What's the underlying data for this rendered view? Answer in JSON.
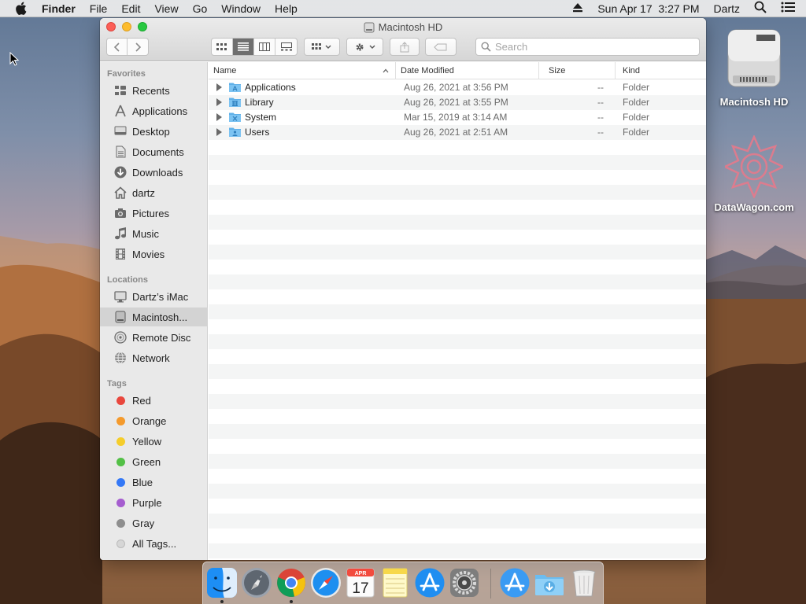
{
  "menubar": {
    "app_name": "Finder",
    "menus": [
      "File",
      "Edit",
      "View",
      "Go",
      "Window",
      "Help"
    ],
    "clock": "Sun Apr 17  3:27 PM",
    "user": "Dartz"
  },
  "window": {
    "title": "Macintosh HD",
    "search_placeholder": "Search"
  },
  "sidebar": {
    "favorites_header": "Favorites",
    "favorites": [
      {
        "label": "Recents",
        "icon": "recents-icon"
      },
      {
        "label": "Applications",
        "icon": "applications-icon"
      },
      {
        "label": "Desktop",
        "icon": "desktop-icon"
      },
      {
        "label": "Documents",
        "icon": "documents-icon"
      },
      {
        "label": "Downloads",
        "icon": "downloads-icon"
      },
      {
        "label": "dartz",
        "icon": "home-icon"
      },
      {
        "label": "Pictures",
        "icon": "pictures-icon"
      },
      {
        "label": "Music",
        "icon": "music-icon"
      },
      {
        "label": "Movies",
        "icon": "movies-icon"
      }
    ],
    "locations_header": "Locations",
    "locations": [
      {
        "label": "Dartz’s iMac",
        "icon": "imac-icon"
      },
      {
        "label": "Macintosh...",
        "icon": "hard-drive-icon",
        "selected": true
      },
      {
        "label": "Remote Disc",
        "icon": "remote-disc-icon"
      },
      {
        "label": "Network",
        "icon": "network-icon"
      }
    ],
    "tags_header": "Tags",
    "tags": [
      {
        "label": "Red",
        "color": "#e9473d"
      },
      {
        "label": "Orange",
        "color": "#f49a2c"
      },
      {
        "label": "Yellow",
        "color": "#f5cd2b"
      },
      {
        "label": "Green",
        "color": "#53c046"
      },
      {
        "label": "Blue",
        "color": "#3478f6"
      },
      {
        "label": "Purple",
        "color": "#a55dcf"
      },
      {
        "label": "Gray",
        "color": "#8e8e8e"
      },
      {
        "label": "All Tags...",
        "color": "#d6d6d6"
      }
    ]
  },
  "list": {
    "columns": {
      "name": "Name",
      "date": "Date Modified",
      "size": "Size",
      "kind": "Kind"
    },
    "rows": [
      {
        "name": "Applications",
        "date": "Aug 26, 2021 at 3:56 PM",
        "size": "--",
        "kind": "Folder"
      },
      {
        "name": "Library",
        "date": "Aug 26, 2021 at 3:55 PM",
        "size": "--",
        "kind": "Folder"
      },
      {
        "name": "System",
        "date": "Mar 15, 2019 at 3:14 AM",
        "size": "--",
        "kind": "Folder"
      },
      {
        "name": "Users",
        "date": "Aug 26, 2021 at 2:51 AM",
        "size": "--",
        "kind": "Folder"
      }
    ]
  },
  "desktop_icons": [
    {
      "label": "Macintosh HD",
      "icon": "hard-drive-icon"
    },
    {
      "label": "DataWagon.com",
      "icon": "datawagon-logo-icon"
    }
  ],
  "dock": {
    "calendar_month": "APR",
    "calendar_day": "17",
    "apps": [
      "finder-icon",
      "launchpad-icon",
      "chrome-icon",
      "safari-icon",
      "calendar-icon",
      "notes-icon",
      "app-store-icon",
      "system-preferences-icon",
      "app-store-icon",
      "downloads-folder-icon",
      "trash-icon"
    ]
  }
}
